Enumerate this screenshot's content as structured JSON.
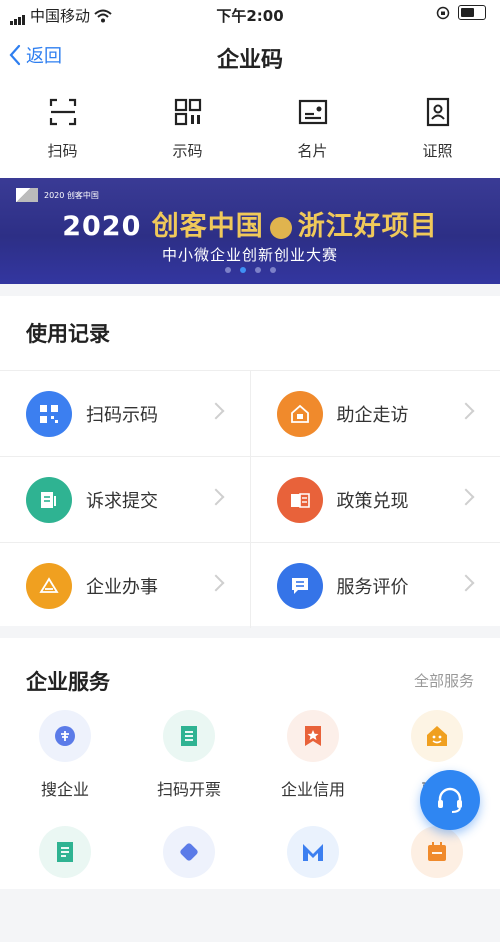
{
  "status_bar": {
    "carrier": "中国移动",
    "time": "下午2:00"
  },
  "nav": {
    "back_label": "返回",
    "title": "企业码"
  },
  "quick_actions": [
    {
      "label": "扫码",
      "icon": "scan-icon"
    },
    {
      "label": "示码",
      "icon": "qr-code-icon"
    },
    {
      "label": "名片",
      "icon": "business-card-icon"
    },
    {
      "label": "证照",
      "icon": "license-icon"
    }
  ],
  "banner": {
    "logo_text": "2020 创客中国",
    "year": "2020",
    "title_a": "创客中国",
    "title_b": "浙江好项目",
    "subtitle": "中小微企业创新创业大赛",
    "slide_count": 4,
    "active_slide": 2
  },
  "records": {
    "title": "使用记录",
    "items": [
      {
        "label": "扫码示码",
        "icon": "qr-grid-icon",
        "color": "#3c7ff0"
      },
      {
        "label": "助企走访",
        "icon": "company-visit-icon",
        "color": "#f08a2c"
      },
      {
        "label": "诉求提交",
        "icon": "document-submit-icon",
        "color": "#2fb392"
      },
      {
        "label": "政策兑现",
        "icon": "policy-icon",
        "color": "#e8623a"
      },
      {
        "label": "企业办事",
        "icon": "affairs-icon",
        "color": "#f0a020"
      },
      {
        "label": "服务评价",
        "icon": "rating-message-icon",
        "color": "#3574e8"
      }
    ]
  },
  "services": {
    "title": "企业服务",
    "all_label": "全部服务",
    "items": [
      {
        "label": "搜企业",
        "icon": "search-company-icon",
        "color": "#5b7be8"
      },
      {
        "label": "扫码开票",
        "icon": "invoice-icon",
        "color": "#2fb392"
      },
      {
        "label": "企业信用",
        "icon": "credit-star-icon",
        "color": "#e8623a"
      },
      {
        "label": "惠企",
        "icon": "smile-house-icon",
        "color": "#f0a020"
      },
      {
        "label": "",
        "icon": "document-icon",
        "color": "#2fb392"
      },
      {
        "label": "",
        "icon": "diamond-icon",
        "color": "#5b7be8"
      },
      {
        "label": "",
        "icon": "m-logo-icon",
        "color": "#3c7ff0"
      },
      {
        "label": "",
        "icon": "calendar-icon",
        "color": "#f08a2c"
      }
    ]
  },
  "colors": {
    "accent": "#2f7ff0",
    "banner_bg": "#2d2f86",
    "banner_gold": "#f0c95a"
  }
}
